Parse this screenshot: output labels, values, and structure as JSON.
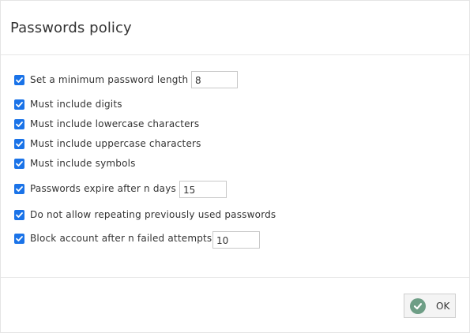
{
  "dialog": {
    "title": "Passwords policy"
  },
  "options": [
    {
      "label": "Set a minimum password length",
      "checked": true,
      "value": "8"
    },
    {
      "label": "Must include digits",
      "checked": true
    },
    {
      "label": "Must include lowercase characters",
      "checked": true
    },
    {
      "label": "Must include uppercase characters",
      "checked": true
    },
    {
      "label": "Must include symbols",
      "checked": true
    },
    {
      "label": "Passwords expire after n days",
      "checked": true,
      "value": "15"
    },
    {
      "label": "Do not allow repeating previously used passwords",
      "checked": true
    },
    {
      "label": "Block account after n failed attempts",
      "checked": true,
      "value": "10"
    }
  ],
  "footer": {
    "ok_label": "OK"
  },
  "colors": {
    "checkbox": "#1a73e8",
    "ok_icon": "#6e9e86"
  }
}
